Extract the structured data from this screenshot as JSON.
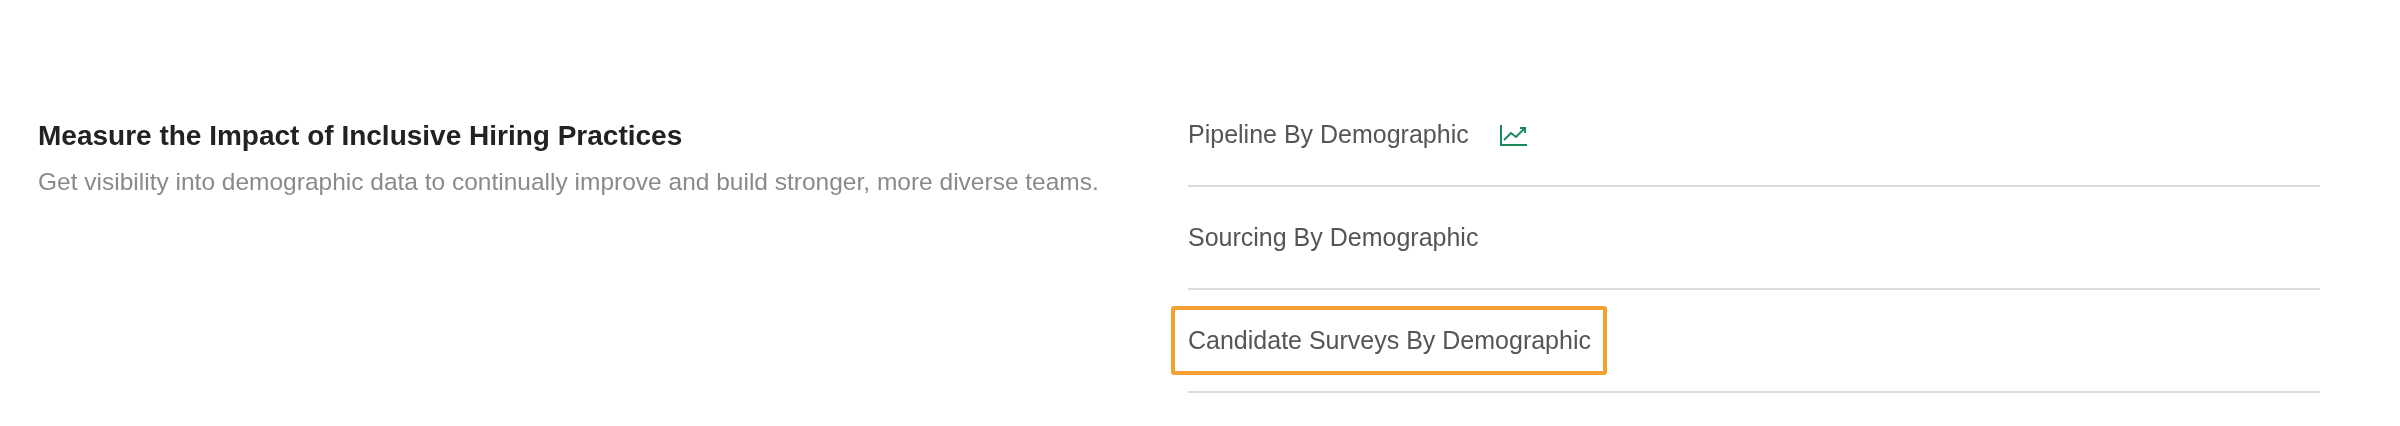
{
  "section": {
    "title": "Measure the Impact of Inclusive Hiring Practices",
    "description": "Get visibility into demographic data to continually improve and build stronger, more diverse teams."
  },
  "reports": [
    {
      "label": "Pipeline By Demographic",
      "chart_icon": true,
      "highlighted": false
    },
    {
      "label": "Sourcing By Demographic",
      "chart_icon": false,
      "highlighted": false
    },
    {
      "label": "Candidate Surveys By Demographic",
      "chart_icon": false,
      "highlighted": true
    }
  ]
}
